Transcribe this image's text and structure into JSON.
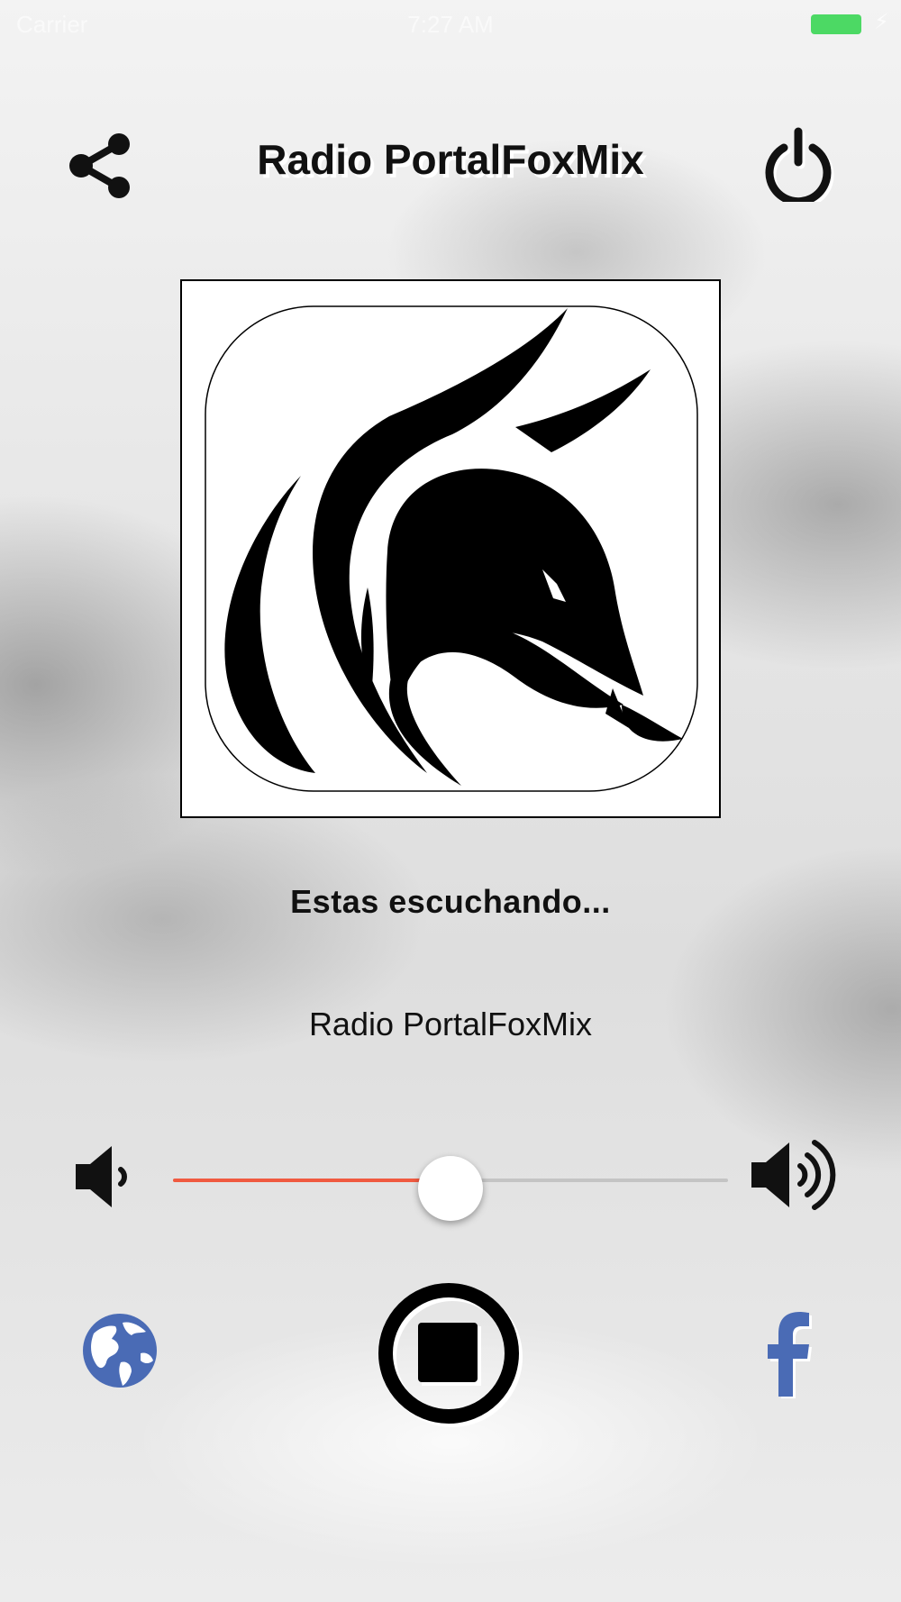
{
  "status_bar": {
    "carrier": "Carrier",
    "time": "7:27 AM"
  },
  "header": {
    "title": "Radio PortalFoxMix",
    "share_icon": "share-icon",
    "power_icon": "power-icon"
  },
  "logo": {
    "icon": "fox-logo"
  },
  "now_playing": {
    "label": "Estas escuchando...",
    "station": "Radio PortalFoxMix"
  },
  "volume": {
    "level": 0.5,
    "low_icon": "volume-low-icon",
    "high_icon": "volume-high-icon",
    "fill_color": "#f05a40"
  },
  "controls": {
    "globe_icon": "globe-icon",
    "stop_icon": "stop-icon",
    "facebook_icon": "facebook-icon",
    "brand_color": "#4a6bb5"
  }
}
